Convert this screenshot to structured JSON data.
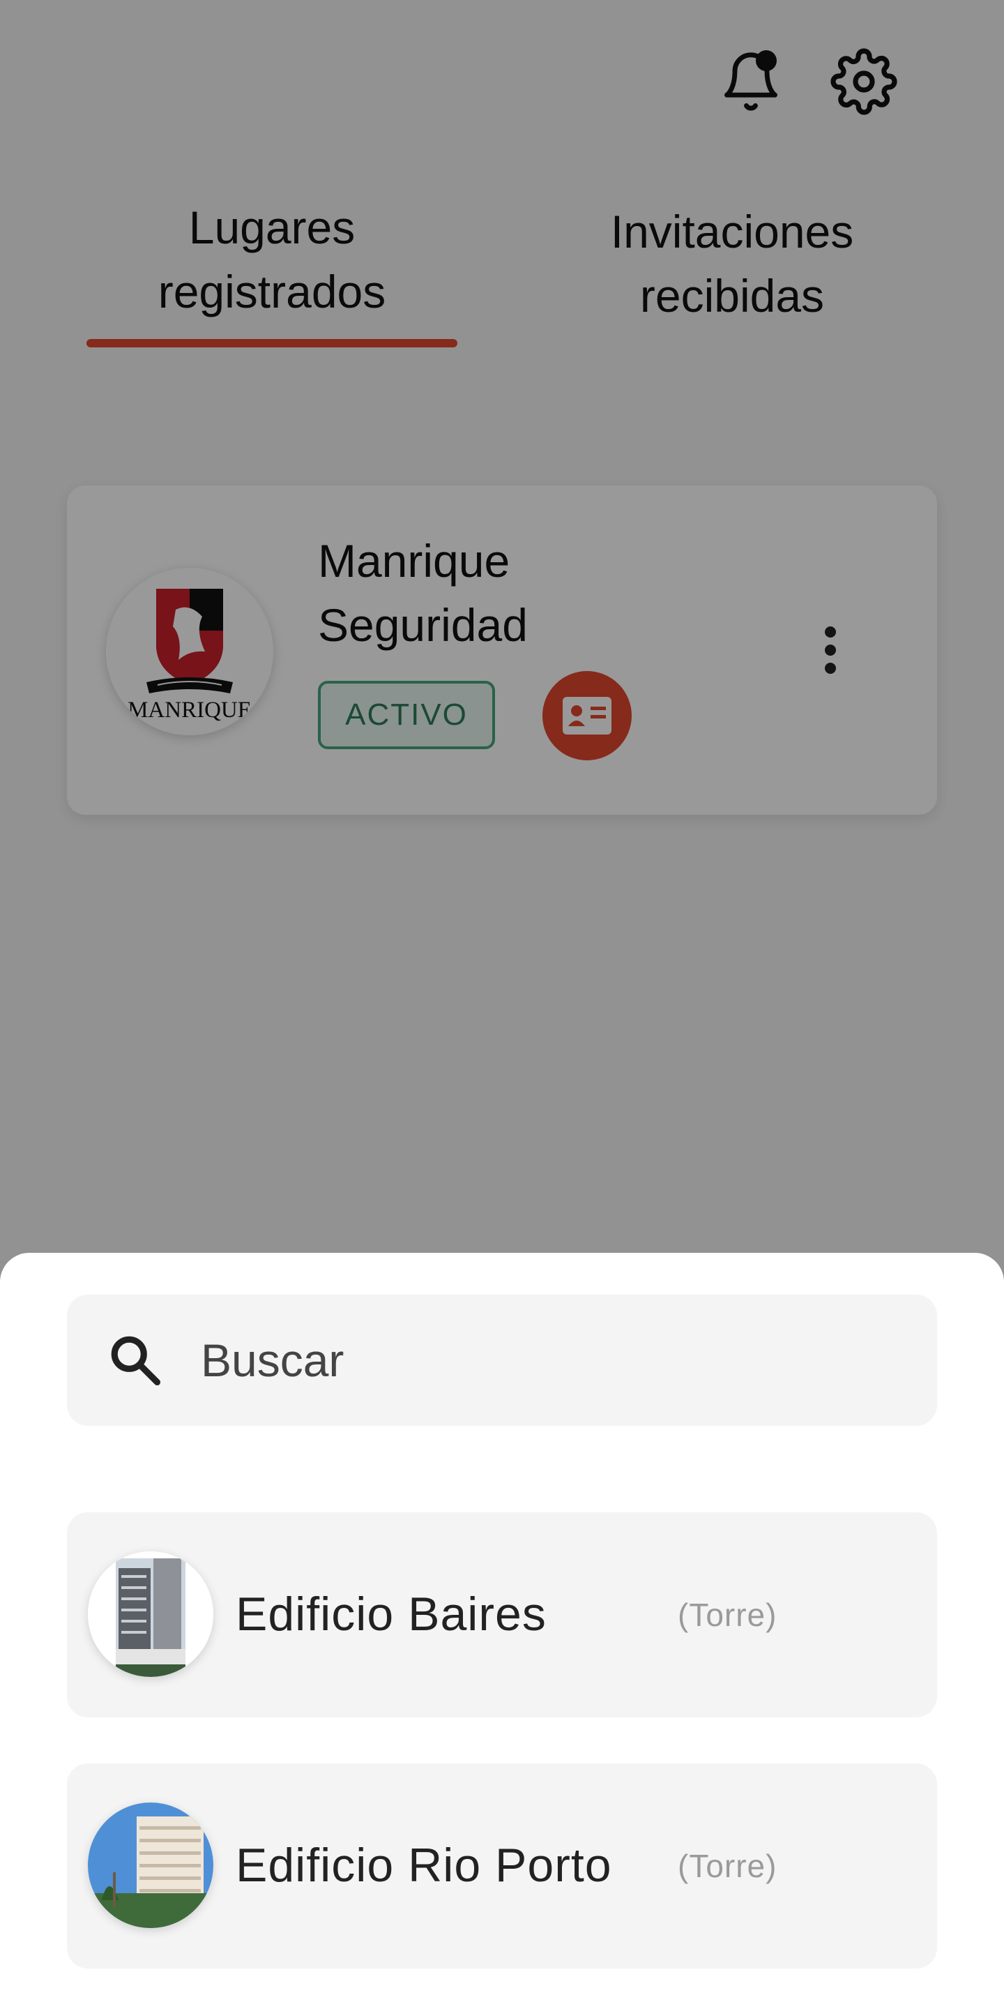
{
  "header": {
    "notifications_icon": "bell-icon",
    "settings_icon": "gear-icon"
  },
  "tabs": [
    {
      "label": "Lugares registrados",
      "active": true
    },
    {
      "label": "Invitaciones recibidas",
      "active": false
    }
  ],
  "places": [
    {
      "name": "Manrique Seguridad",
      "logo_text": "MANRIQUE",
      "status": "ACTIVO",
      "id_card_icon": "id-card-icon",
      "menu_icon": "more-vertical-icon"
    }
  ],
  "search": {
    "placeholder": "Buscar",
    "icon": "search-icon"
  },
  "results": [
    {
      "name": "Edificio Baires",
      "type": "(Torre)"
    },
    {
      "name": "Edificio Rio Porto",
      "type": "(Torre)"
    }
  ],
  "colors": {
    "accent": "#e0472d",
    "status_active_border": "#46a37c",
    "status_active_text": "#2d7b5b",
    "overlay": "rgba(0,0,0,0.40)"
  }
}
